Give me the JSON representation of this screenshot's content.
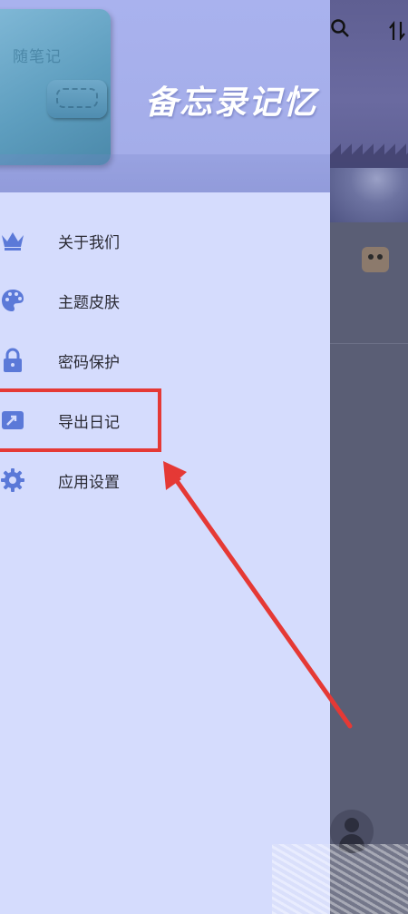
{
  "app": {
    "title": "备忘录记忆",
    "notebook_emboss": "随笔记"
  },
  "menu": {
    "items": [
      {
        "label": "关于我们",
        "icon": "crown-icon"
      },
      {
        "label": "主题皮肤",
        "icon": "palette-icon"
      },
      {
        "label": "密码保护",
        "icon": "lock-icon"
      },
      {
        "label": "导出日记",
        "icon": "export-icon"
      },
      {
        "label": "应用设置",
        "icon": "gear-icon"
      }
    ]
  },
  "colors": {
    "drawer_bg": "#d5dcfd",
    "header_bg": "#a9b2ee",
    "icon_accent": "#5b79d8",
    "annotation_red": "#e53935"
  }
}
